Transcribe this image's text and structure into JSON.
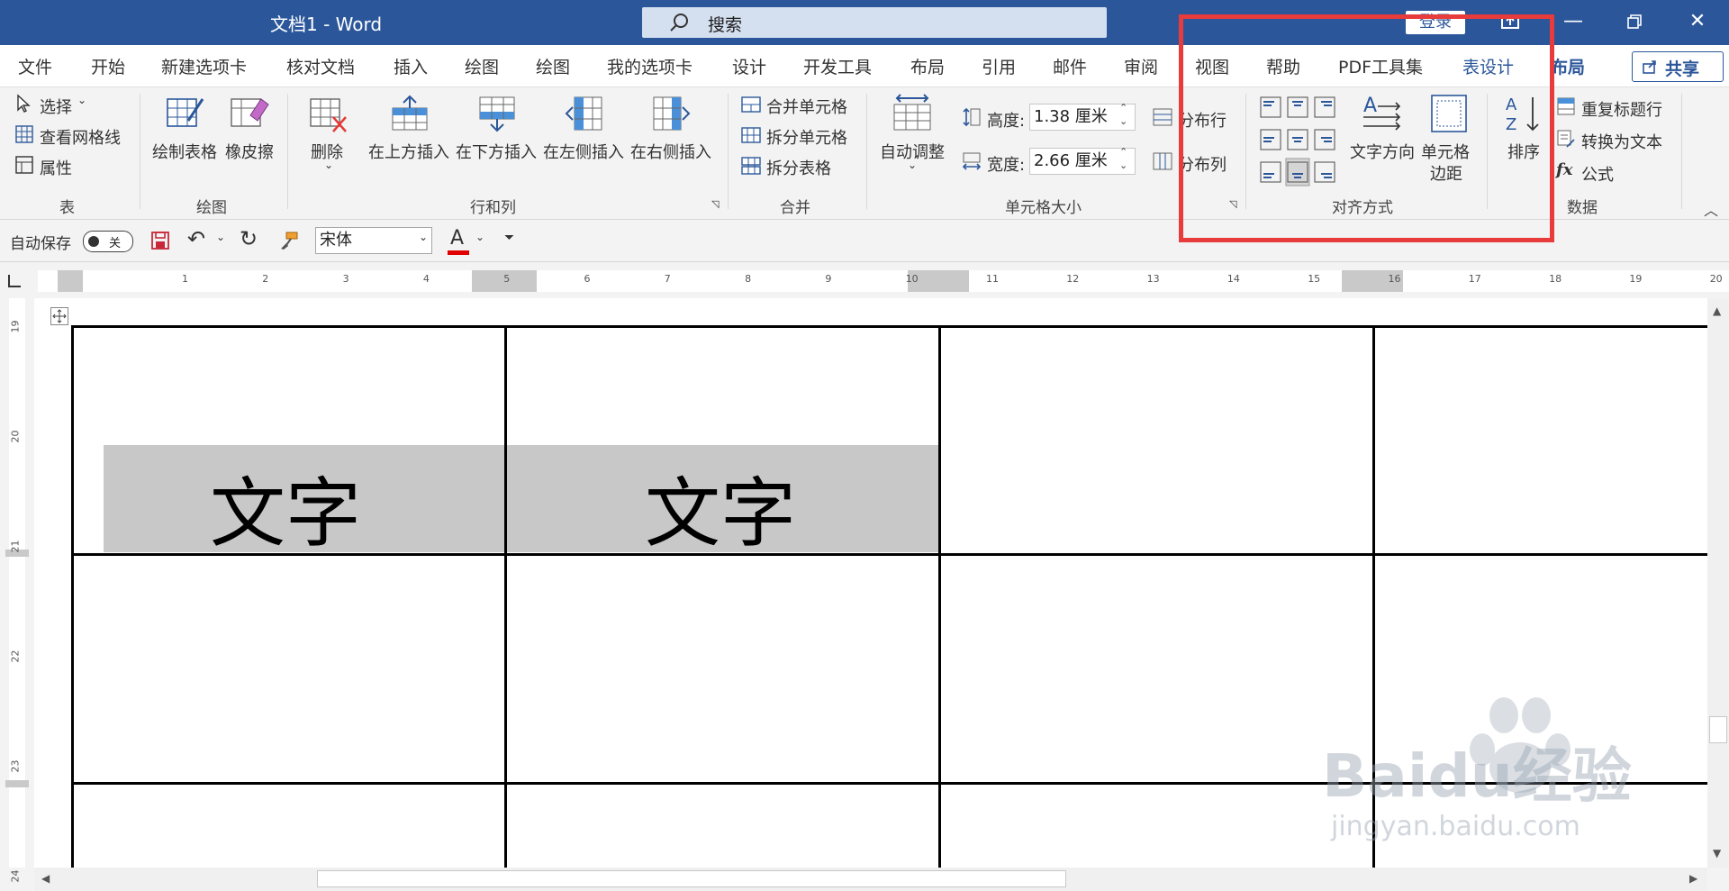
{
  "window": {
    "title": "文档1  -  Word",
    "search_placeholder": "搜索",
    "login": "登录"
  },
  "tabs": [
    {
      "label": "文件"
    },
    {
      "label": "开始"
    },
    {
      "label": "新建选项卡"
    },
    {
      "label": "核对文档"
    },
    {
      "label": "插入"
    },
    {
      "label": "绘图"
    },
    {
      "label": "绘图"
    },
    {
      "label": "我的选项卡"
    },
    {
      "label": "设计"
    },
    {
      "label": "开发工具"
    },
    {
      "label": "布局"
    },
    {
      "label": "引用"
    },
    {
      "label": "邮件"
    },
    {
      "label": "审阅"
    },
    {
      "label": "视图"
    },
    {
      "label": "帮助"
    },
    {
      "label": "PDF工具集"
    },
    {
      "label": "表设计"
    },
    {
      "label": "布局"
    }
  ],
  "share_label": "共享",
  "ribbon": {
    "table_group": {
      "label": "表",
      "select": "选择",
      "gridlines": "查看网格线",
      "properties": "属性"
    },
    "draw_group": {
      "label": "绘图",
      "draw_table": "绘制表格",
      "eraser": "橡皮擦"
    },
    "rows_cols_group": {
      "label": "行和列",
      "delete": "删除",
      "insert_above": "在上方插入",
      "insert_below": "在下方插入",
      "insert_left": "在左侧插入",
      "insert_right": "在右侧插入"
    },
    "merge_group": {
      "label": "合并",
      "merge_cells": "合并单元格",
      "split_cells": "拆分单元格",
      "split_table": "拆分表格"
    },
    "cell_size_group": {
      "label": "单元格大小",
      "autofit": "自动调整",
      "height_label": "高度:",
      "height_value": "1.38 厘米",
      "width_label": "宽度:",
      "width_value": "2.66 厘米",
      "distribute_rows": "分布行",
      "distribute_cols": "分布列"
    },
    "alignment_group": {
      "label": "对齐方式",
      "text_direction": "文字方向",
      "cell_margins_line1": "单元格",
      "cell_margins_line2": "边距",
      "sort": "排序"
    },
    "data_group": {
      "label": "数据",
      "repeat_header": "重复标题行",
      "convert_text": "转换为文本",
      "formula": "公式"
    }
  },
  "qat": {
    "autosave_label": "自动保存",
    "autosave_state": "关",
    "font_name": "宋体"
  },
  "ruler": {
    "numbers": [
      "1",
      "2",
      "3",
      "4",
      "5",
      "6",
      "7",
      "8",
      "9",
      "10",
      "11",
      "12",
      "13",
      "14",
      "15",
      "16",
      "17",
      "18",
      "19",
      "20"
    ],
    "vertical_numbers": [
      "19",
      "20",
      "21",
      "22",
      "23",
      "24"
    ]
  },
  "table": {
    "cells_text": [
      "文字",
      "文字"
    ]
  },
  "watermark": {
    "text": "Baidu经验",
    "sub": "jingyan.baidu.com"
  },
  "colors": {
    "accent": "#2b579a",
    "highlight": "#e83b3b",
    "cell_shade": "#c8c8c8"
  }
}
